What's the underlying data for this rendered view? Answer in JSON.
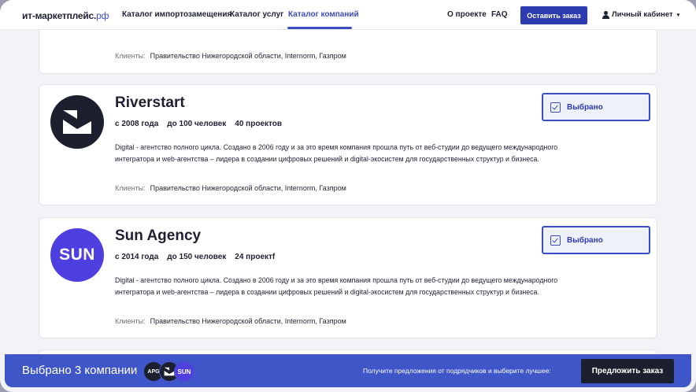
{
  "header": {
    "logo_main": "ит-маркетплейс.",
    "logo_tld": "рф",
    "nav": [
      "Каталог импортозамещения",
      "Каталог услуг",
      "Каталог компаний"
    ],
    "about": "О проекте",
    "faq": "FAQ",
    "order_button": "Оставить заказ",
    "cabinet": "Личный кабинет"
  },
  "top_card": {
    "clients_label": "Клиенты:",
    "clients": "Правительство Нижегородской области, Internorm, Газпром"
  },
  "companies": [
    {
      "name": "Riverstart",
      "since": "с 2008 года",
      "staff": "до 100 человек",
      "projects": "40 проектов",
      "desc_line1": "Digital - агентство полного цикла. Создано в 2006 году и за это время компания прошла путь от веб-студии до ведущего международного",
      "desc_line2": "интегратора и web-агентства – лидера в создании цифровых решений и digital-экосистем для государственных структур и бизнеса.",
      "clients_label": "Клиенты:",
      "clients": "Правительство Нижегородской области, Internorm, Газпром",
      "selected_label": "Выбрано"
    },
    {
      "name": "Sun Agency",
      "logo_text": "SUN",
      "since": "с 2014 года",
      "staff": "до 150 человек",
      "projects": "24 проектf",
      "desc_line1": "Digital - агентство полного цикла. Создано в 2006 году и за это время компания прошла путь от веб-студии до ведущего международного",
      "desc_line2": "интегратора и web-агентства – лидера в создании цифровых решений и digital-экосистем для государственных структур и бизнеса.",
      "clients_label": "Клиенты:",
      "clients": "Правительство Нижегородской области, Internorm, Газпром",
      "selected_label": "Выбрано"
    }
  ],
  "bottom_bar": {
    "title": "Выбрано 3 компании",
    "avatars": [
      "APG",
      "",
      "SUN"
    ],
    "hint": "Получите предложения от подрядчиков и выберите лучшее:",
    "button": "Предложить заказ"
  },
  "colors": {
    "accent": "#3a4dc4",
    "bar": "#3f56c8",
    "dark": "#1b1f2e",
    "sun": "#4f3ee0"
  }
}
